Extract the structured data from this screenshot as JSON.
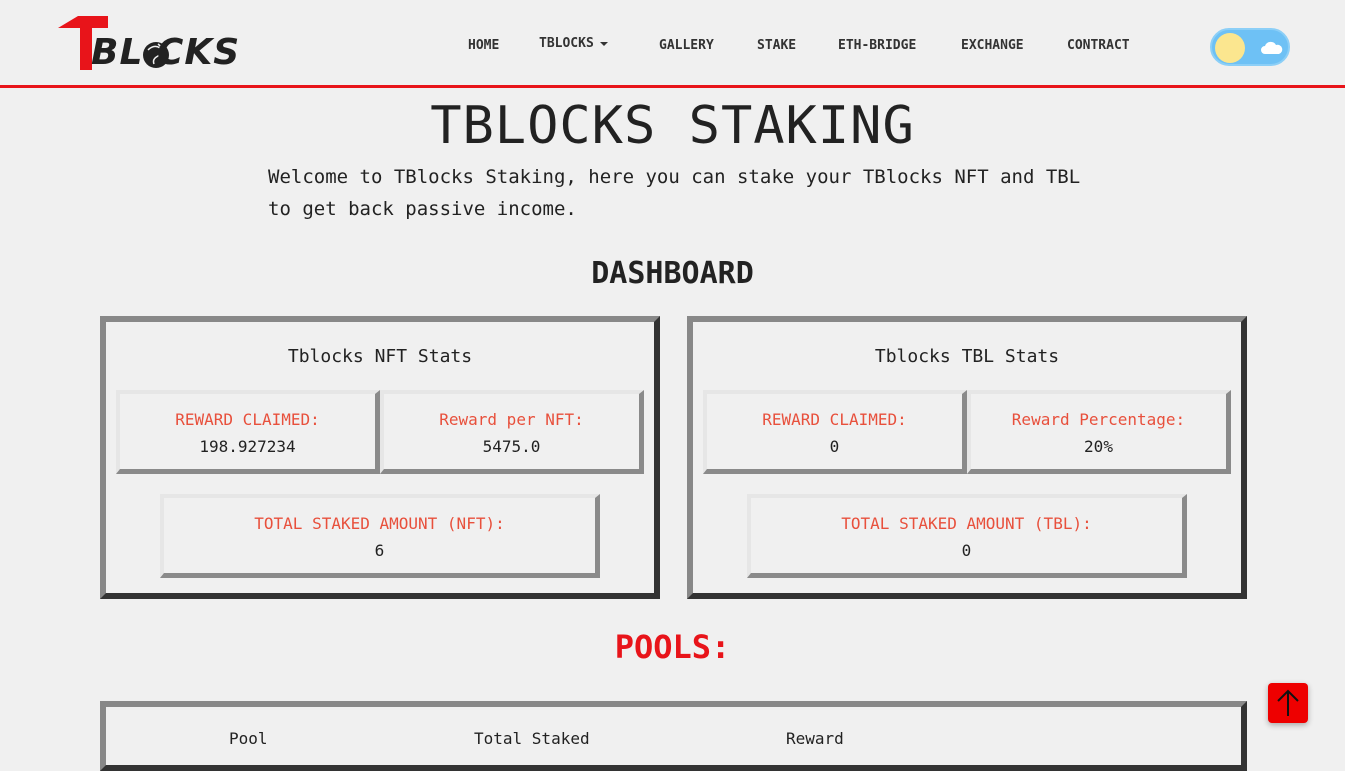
{
  "header": {
    "logo_text": "BL CKS",
    "nav": [
      {
        "label": "HOME"
      },
      {
        "label": "TBLOCKS"
      },
      {
        "label": "GALLERY"
      },
      {
        "label": "STAKE"
      },
      {
        "label": "ETH-BRIDGE"
      },
      {
        "label": "EXCHANGE"
      },
      {
        "label": "CONTRACT"
      }
    ],
    "theme_toggle": {
      "icon_left": "sun-icon",
      "icon_right": "cloud-icon",
      "state": "light"
    }
  },
  "main": {
    "title": "TBLOCKS STAKING",
    "intro": "Welcome to TBlocks Staking, here you can stake your TBlocks NFT and TBL to get back passive income.",
    "dashboard_title": "DASHBOARD",
    "nft_panel": {
      "title": "Tblocks NFT Stats",
      "reward_claimed_label": "REWARD CLAIMED:",
      "reward_claimed_value": "198.927234",
      "reward_per_label": "Reward per NFT:",
      "reward_per_value": "5475.0",
      "total_staked_label": "TOTAL STAKED AMOUNT (NFT):",
      "total_staked_value": "6"
    },
    "tbl_panel": {
      "title": "Tblocks TBL Stats",
      "reward_claimed_label": "REWARD CLAIMED:",
      "reward_claimed_value": "0",
      "reward_pct_label": "Reward Percentage:",
      "reward_pct_value": "20%",
      "total_staked_label": "TOTAL STAKED AMOUNT (TBL):",
      "total_staked_value": "0"
    },
    "pools_title": "POOLS:",
    "pools_table": {
      "columns": [
        "Pool",
        "Total Staked",
        "Reward"
      ]
    }
  },
  "colors": {
    "accent": "#e8141a",
    "label": "#e8503c",
    "toggle_bg": "#6ec1f5",
    "sun": "#fbe68f"
  },
  "back_to_top_icon": "arrow-up-icon"
}
